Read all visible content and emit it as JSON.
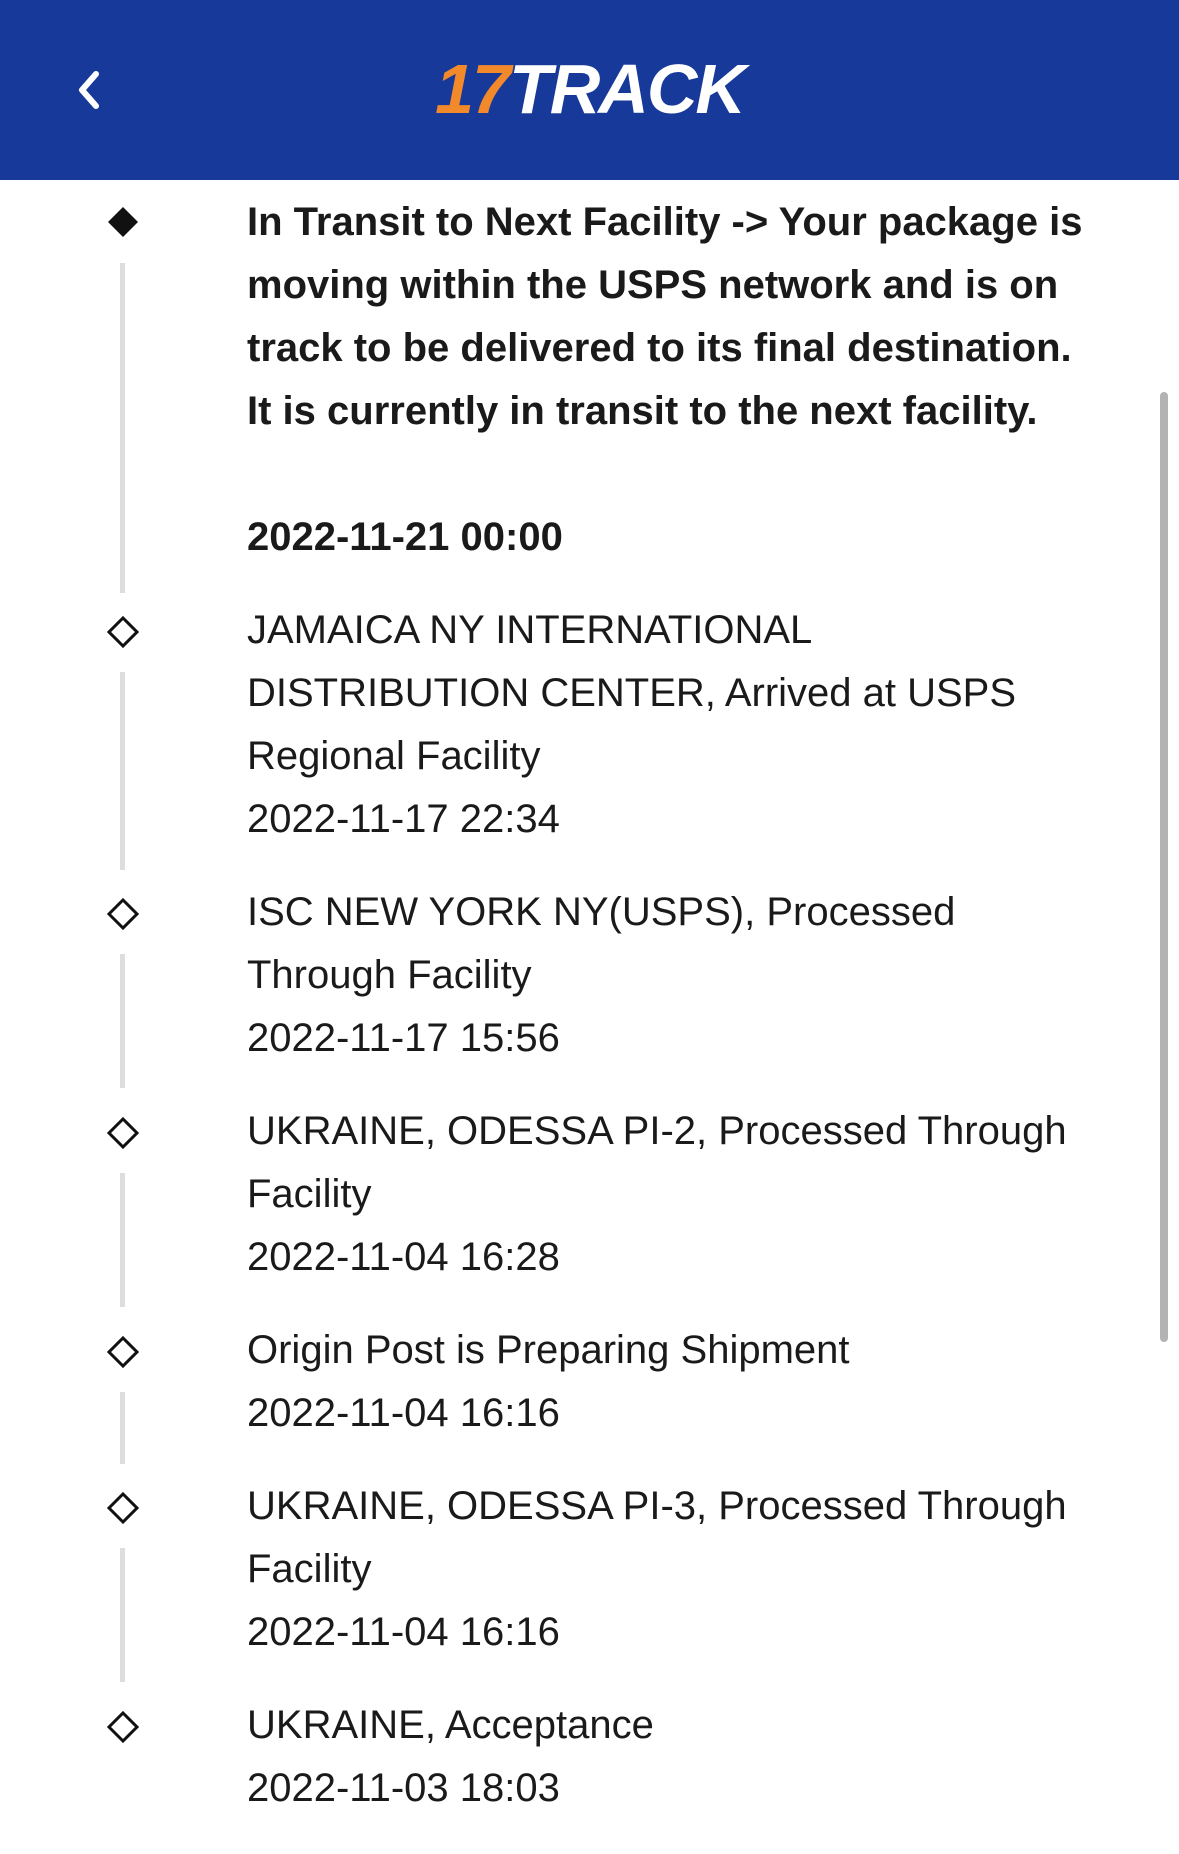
{
  "header": {
    "logo_number": "17",
    "logo_word": "TRACK",
    "colors": {
      "bar": "#17399a",
      "accent": "#f2892b"
    }
  },
  "events": [
    {
      "description": "In Transit to Next Facility -> Your package is moving within the USPS network and is on track to be delivered to its final destination. It is currently in transit to the next facility.",
      "datetime": "2022-11-21 00:00",
      "current": true
    },
    {
      "description": "JAMAICA NY INTERNATIONAL DISTRIBUTION CENTER, Arrived at USPS Regional Facility",
      "datetime": "2022-11-17 22:34",
      "current": false
    },
    {
      "description": "ISC NEW YORK NY(USPS), Processed Through Facility",
      "datetime": "2022-11-17 15:56",
      "current": false
    },
    {
      "description": "UKRAINE, ODESSA PI-2, Processed Through Facility",
      "datetime": "2022-11-04 16:28",
      "current": false
    },
    {
      "description": "Origin Post is Preparing Shipment",
      "datetime": "2022-11-04 16:16",
      "current": false
    },
    {
      "description": "UKRAINE, ODESSA PI-3, Processed Through Facility",
      "datetime": "2022-11-04 16:16",
      "current": false
    },
    {
      "description": "UKRAINE, Acceptance",
      "datetime": "2022-11-03 18:03",
      "current": false
    }
  ]
}
